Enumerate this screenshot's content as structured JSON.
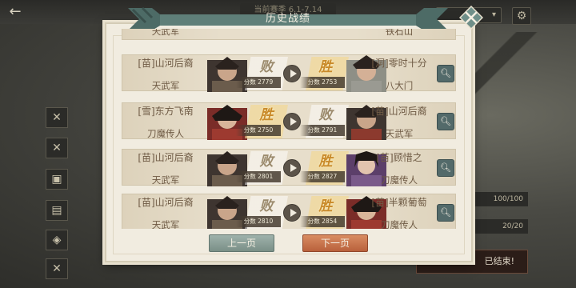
{
  "background": {
    "header_text": "当前赛季 6.1-7.14",
    "dropdown_label": "▾",
    "stats": [
      "100/100",
      "20/20"
    ],
    "finished_text": "已结束!"
  },
  "dialog": {
    "title": "历史战绩",
    "prev_label": "上一页",
    "next_label": "下一页"
  },
  "rows": [
    {
      "left_name": "[苗]山河后裔",
      "left_sect": "天武军",
      "left_result": "败",
      "left_score": "分数 2779",
      "right_name": "[洞]零时十分",
      "right_sect": "八大门",
      "right_result": "胜",
      "right_score": "分数 2753"
    },
    {
      "left_name": "[雪]东方飞南",
      "left_sect": "刀魔传人",
      "left_result": "胜",
      "left_score": "分数 2750",
      "right_name": "[苗]山河后裔",
      "right_sect": "天武军",
      "right_result": "败",
      "right_score": "分数 2791"
    },
    {
      "left_name": "[苗]山河后裔",
      "left_sect": "天武军",
      "left_result": "败",
      "left_score": "分数 2801",
      "right_name": "[苗]顾惜之",
      "right_sect": "刀魔传人",
      "right_result": "胜",
      "right_score": "分数 2827"
    },
    {
      "left_name": "[苗]山河后裔",
      "left_sect": "天武军",
      "left_result": "败",
      "left_score": "分数 2810",
      "right_name": "[苗]半颗葡萄",
      "right_sect": "刀魔传人",
      "right_result": "胜",
      "right_score": "分数 2854"
    }
  ],
  "partial_row": {
    "left_sect": "天武军",
    "right_sect": "铁石山"
  },
  "icons": {
    "back": "back-arrow-icon",
    "close": "close-icon",
    "play": "play-icon",
    "search": "search-icon",
    "settings": "gear-icon"
  }
}
